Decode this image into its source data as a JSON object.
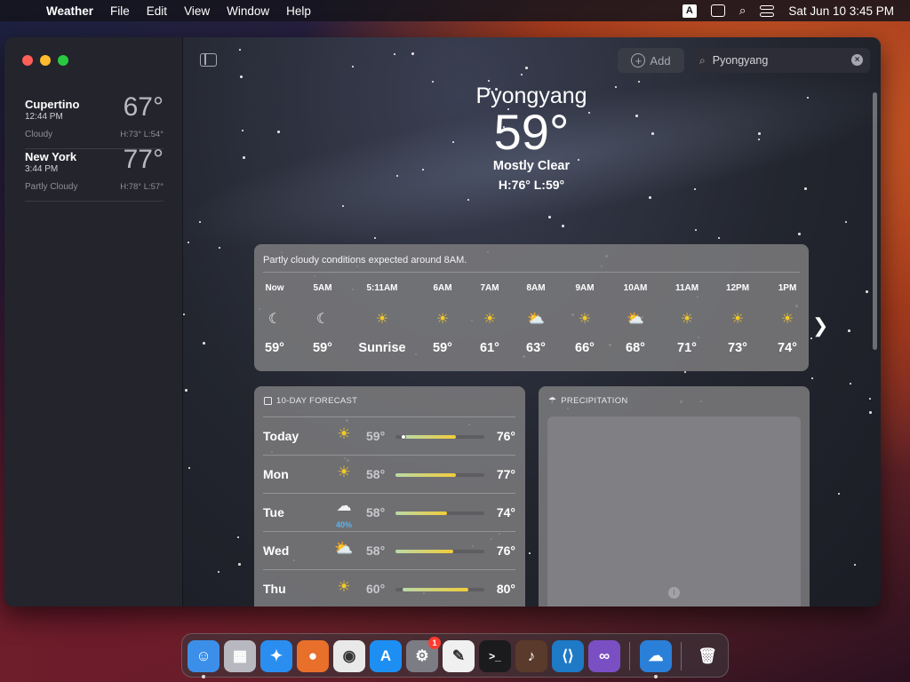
{
  "menubar": {
    "app_name": "Weather",
    "menus": [
      "File",
      "Edit",
      "View",
      "Window",
      "Help"
    ],
    "input_source": "A",
    "datetime": "Sat Jun 10  3:45 PM"
  },
  "sidebar": {
    "locations": [
      {
        "city": "Cupertino",
        "time": "12:44 PM",
        "temp": "67°",
        "condition": "Cloudy",
        "hilo": "H:73°  L:54°"
      },
      {
        "city": "New York",
        "time": "3:44 PM",
        "temp": "77°",
        "condition": "Partly Cloudy",
        "hilo": "H:78°  L:57°"
      }
    ]
  },
  "toolbar": {
    "add_label": "Add",
    "search_value": "Pyongyang"
  },
  "current": {
    "city": "Pyongyang",
    "temp": "59°",
    "condition": "Mostly Clear",
    "hilo": "H:76°  L:59°"
  },
  "hourly": {
    "summary": "Partly cloudy conditions expected around 8AM.",
    "items": [
      {
        "time": "Now",
        "icon": "moon-icon",
        "temp": "59°"
      },
      {
        "time": "5AM",
        "icon": "moon-icon",
        "temp": "59°"
      },
      {
        "time": "5:11AM",
        "icon": "sunrise-icon",
        "temp": "Sunrise"
      },
      {
        "time": "6AM",
        "icon": "sun-icon",
        "temp": "59°"
      },
      {
        "time": "7AM",
        "icon": "sun-icon",
        "temp": "61°"
      },
      {
        "time": "8AM",
        "icon": "partly-cloudy-icon",
        "temp": "63°"
      },
      {
        "time": "9AM",
        "icon": "sun-icon",
        "temp": "66°"
      },
      {
        "time": "10AM",
        "icon": "partly-cloudy-icon",
        "temp": "68°"
      },
      {
        "time": "11AM",
        "icon": "sun-icon",
        "temp": "71°"
      },
      {
        "time": "12PM",
        "icon": "sun-icon",
        "temp": "73°"
      },
      {
        "time": "1PM",
        "icon": "sun-icon",
        "temp": "74°"
      }
    ]
  },
  "forecast": {
    "header": "10-DAY FORECAST",
    "days": [
      {
        "day": "Today",
        "icon": "sun-icon",
        "precip": "",
        "low": "59°",
        "high": "76°",
        "range_start": 0.09,
        "range_end": 0.68,
        "current_marker": 0.09
      },
      {
        "day": "Mon",
        "icon": "sun-icon",
        "precip": "",
        "low": "58°",
        "high": "77°",
        "range_start": 0.0,
        "range_end": 0.68
      },
      {
        "day": "Tue",
        "icon": "cloud-icon",
        "precip": "40%",
        "low": "58°",
        "high": "74°",
        "range_start": 0.0,
        "range_end": 0.58
      },
      {
        "day": "Wed",
        "icon": "partly-cloudy-icon",
        "precip": "",
        "low": "58°",
        "high": "76°",
        "range_start": 0.0,
        "range_end": 0.65
      },
      {
        "day": "Thu",
        "icon": "sun-icon",
        "precip": "",
        "low": "60°",
        "high": "80°",
        "range_start": 0.08,
        "range_end": 0.82
      }
    ]
  },
  "precipitation": {
    "header": "PRECIPITATION"
  },
  "dock": {
    "apps": [
      "finder-icon",
      "launchpad-icon",
      "safari-icon",
      "firefox-icon",
      "chrome-icon",
      "app-store-icon",
      "system-settings-icon",
      "textedit-icon",
      "terminal-icon",
      "garageband-icon",
      "vscode-icon",
      "visual-studio-icon",
      "weather-icon",
      "trash-icon"
    ],
    "settings_badge": "1"
  },
  "colors": {
    "sun": "#f5c928",
    "precip_text": "#5ab4f0",
    "card_bg": "#7a7a7c"
  }
}
